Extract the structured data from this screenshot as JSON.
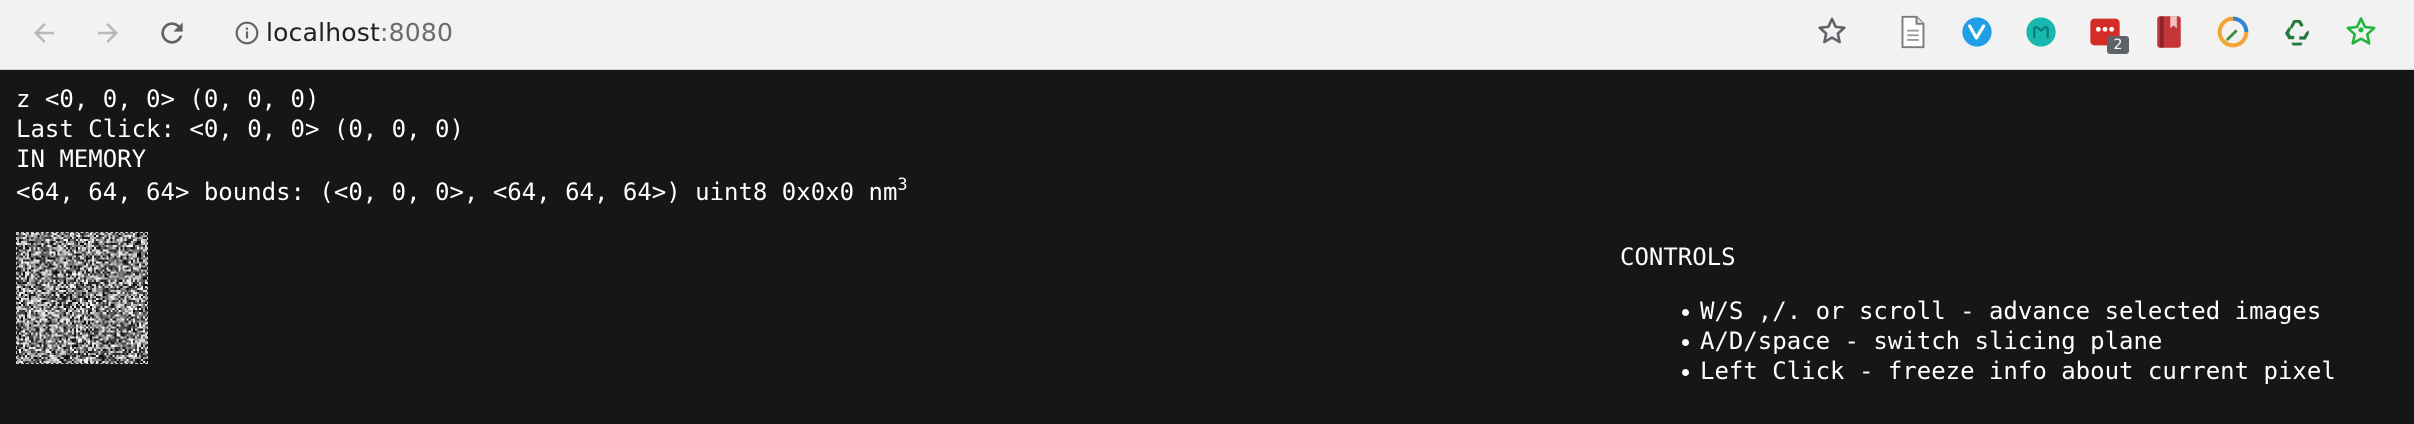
{
  "browser": {
    "url_host": "localhost",
    "url_port": ":8080",
    "extensions": [
      {
        "name": "document-icon"
      },
      {
        "name": "vivaldi-icon"
      },
      {
        "name": "m-icon"
      },
      {
        "name": "lastpass-icon",
        "badge": "2"
      },
      {
        "name": "bookmark-book-icon"
      },
      {
        "name": "compass-pen-icon"
      },
      {
        "name": "recycle-icon"
      },
      {
        "name": "star-person-icon"
      }
    ]
  },
  "info": {
    "z_line": "z <0, 0, 0> (0, 0, 0)",
    "last_click": "Last Click: <0, 0, 0> (0, 0, 0)",
    "memory": "IN MEMORY",
    "bounds": "<64, 64, 64> bounds: (<0, 0, 0>, <64, 64, 64>) uint8 0x0x0 nm",
    "bounds_superscript": "3"
  },
  "controls": {
    "title": "CONTROLS",
    "items": [
      "W/S ,/. or scroll - advance selected images",
      "A/D/space - switch slicing plane",
      "Left Click - freeze info about current pixel"
    ]
  },
  "colors": {
    "page_background": "#161616",
    "text": "#ffffff",
    "chrome_background": "#f2f2f2"
  }
}
